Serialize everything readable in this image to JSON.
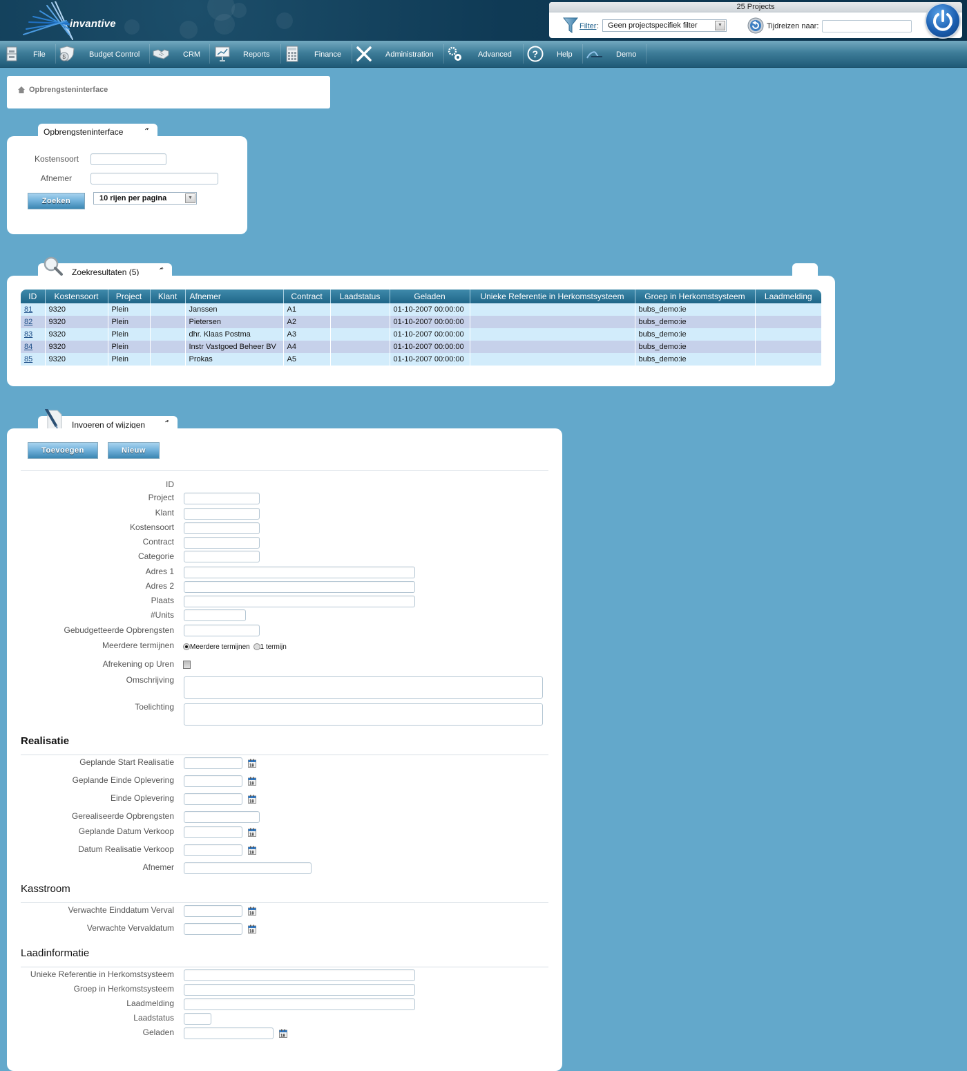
{
  "header": {
    "logo_text": "invantive",
    "project_count": "25 Projects",
    "filter_link": "Filter",
    "filter_colon": ":",
    "filter_value": "Geen projectspecifiek filter",
    "time_travel_label": "Tijdreizen naar:",
    "time_travel_value": ""
  },
  "menu": [
    {
      "label": "File",
      "icon": "file-cabinet-icon"
    },
    {
      "label": "Budget Control",
      "icon": "money-shield-icon"
    },
    {
      "label": "CRM",
      "icon": "handshake-icon"
    },
    {
      "label": "Reports",
      "icon": "presentation-chart-icon"
    },
    {
      "label": "Finance",
      "icon": "calculator-icon"
    },
    {
      "label": "Administration",
      "icon": "tools-icon"
    },
    {
      "label": "Advanced",
      "icon": "gears-icon"
    },
    {
      "label": "Help",
      "icon": "help-icon"
    },
    {
      "label": "Demo",
      "icon": "demo-logo-icon"
    }
  ],
  "breadcrumb": {
    "label": "Opbrengsteninterface"
  },
  "search_panel": {
    "title": "Opbrengsteninterface",
    "fields": {
      "kostensoort_label": "Kostensoort",
      "kostensoort_value": "",
      "afnemer_label": "Afnemer",
      "afnemer_value": ""
    },
    "search_button": "Zoeken",
    "rows_per_page": "10 rijen per pagina"
  },
  "results_panel": {
    "title": "Zoekresultaten (5)",
    "columns": [
      "ID",
      "Kostensoort",
      "Project",
      "Klant",
      "Afnemer",
      "Contract",
      "Laadstatus",
      "Geladen",
      "Unieke Referentie in Herkomstsysteem",
      "Groep in Herkomstsysteem",
      "Laadmelding"
    ],
    "rows": [
      [
        "81",
        "9320",
        "Plein",
        "",
        "Janssen",
        "A1",
        "",
        "01-10-2007 00:00:00",
        "",
        "bubs_demo:ie",
        ""
      ],
      [
        "82",
        "9320",
        "Plein",
        "",
        "Pietersen",
        "A2",
        "",
        "01-10-2007 00:00:00",
        "",
        "bubs_demo:ie",
        ""
      ],
      [
        "83",
        "9320",
        "Plein",
        "",
        "dhr. Klaas Postma",
        "A3",
        "",
        "01-10-2007 00:00:00",
        "",
        "bubs_demo:ie",
        ""
      ],
      [
        "84",
        "9320",
        "Plein",
        "",
        "Instr Vastgoed Beheer BV",
        "A4",
        "",
        "01-10-2007 00:00:00",
        "",
        "bubs_demo:ie",
        ""
      ],
      [
        "85",
        "9320",
        "Plein",
        "",
        "Prokas",
        "A5",
        "",
        "01-10-2007 00:00:00",
        "",
        "bubs_demo:ie",
        ""
      ]
    ]
  },
  "edit_panel": {
    "title": "Invoeren of wijzigen",
    "add_button": "Toevoegen",
    "new_button": "Nieuw",
    "labels": {
      "id": "ID",
      "project": "Project",
      "klant": "Klant",
      "kostensoort": "Kostensoort",
      "contract": "Contract",
      "categorie": "Categorie",
      "adres1": "Adres 1",
      "adres2": "Adres 2",
      "plaats": "Plaats",
      "units": "#Units",
      "budget": "Gebudgetteerde Opbrengsten",
      "termijnen": "Meerdere termijnen",
      "afrekening": "Afrekening op Uren",
      "omschrijving": "Omschrijving",
      "toelichting": "Toelichting"
    },
    "values": {
      "id": "",
      "project": "",
      "klant": "",
      "kostensoort": "",
      "contract": "",
      "categorie": "",
      "adres1": "",
      "adres2": "",
      "plaats": "",
      "units": "",
      "budget": "",
      "omschrijving": "",
      "toelichting": ""
    },
    "termijnen_options": [
      "Meerdere termijnen",
      "1 termijn"
    ],
    "termijnen_selected": "Meerdere termijnen",
    "afrekening_checked": false,
    "realisatie": {
      "title": "Realisatie",
      "labels": {
        "start": "Geplande Start Realisatie",
        "einde_gepland": "Geplande Einde Oplevering",
        "einde": "Einde Oplevering",
        "gerealiseerd": "Gerealiseerde Opbrengsten",
        "datum_verkoop": "Geplande Datum Verkoop",
        "realisatie_verkoop": "Datum Realisatie Verkoop",
        "afnemer": "Afnemer"
      }
    },
    "kasstroom": {
      "title": "Kasstroom",
      "labels": {
        "einddatum": "Verwachte Einddatum Verval",
        "vervaldatum": "Verwachte Vervaldatum"
      }
    },
    "laadinformatie": {
      "title": "Laadinformatie",
      "labels": {
        "referentie": "Unieke Referentie in Herkomstsysteem",
        "groep": "Groep in Herkomstsysteem",
        "melding": "Laadmelding",
        "status": "Laadstatus",
        "geladen": "Geladen"
      }
    },
    "calendar_day": "18"
  }
}
